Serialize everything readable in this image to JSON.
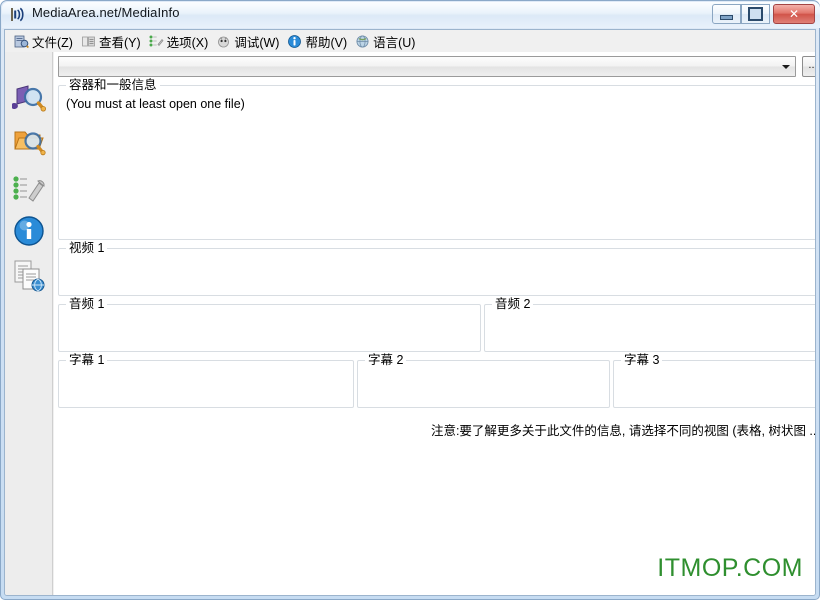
{
  "window": {
    "title": "MediaArea.net/MediaInfo",
    "app_icon": "sound-wave-icon",
    "controls": {
      "minimize": "minimize-button",
      "maximize": "maximize-button",
      "close": "close-button",
      "close_glyph": "✕"
    }
  },
  "menubar": {
    "items": [
      {
        "label": "文件(Z)",
        "icon": "file-icon"
      },
      {
        "label": "查看(Y)",
        "icon": "view-icon"
      },
      {
        "label": "选项(X)",
        "icon": "options-icon"
      },
      {
        "label": "调试(W)",
        "icon": "debug-icon"
      },
      {
        "label": "帮助(V)",
        "icon": "help-icon"
      },
      {
        "label": "语言(U)",
        "icon": "language-icon"
      }
    ]
  },
  "sidebar": {
    "items": [
      {
        "name": "open-file",
        "icon": "open-file-icon"
      },
      {
        "name": "open-folder",
        "icon": "open-folder-icon"
      },
      {
        "name": "options",
        "icon": "wrench-options-icon"
      },
      {
        "name": "about-info",
        "icon": "info-circle-icon"
      },
      {
        "name": "export",
        "icon": "export-documents-icon"
      }
    ]
  },
  "toolbar": {
    "file_combo_value": "",
    "file_combo_placeholder": "",
    "browse_label": "...",
    "dropdown_icon": "chevron-down-icon"
  },
  "panels": {
    "general": {
      "title": "容器和一般信息",
      "body": "(You must at least open one file)"
    },
    "video1": {
      "title": "视频 1",
      "body": ""
    },
    "audio1": {
      "title": "音频 1",
      "body": ""
    },
    "audio2": {
      "title": "音频 2",
      "body": ""
    },
    "subtitle1": {
      "title": "字幕 1",
      "body": ""
    },
    "subtitle2": {
      "title": "字幕 2",
      "body": ""
    },
    "subtitle3": {
      "title": "字幕 3",
      "body": ""
    }
  },
  "note": {
    "text": "注意:要了解更多关于此文件的信息, 请选择不同的视图 (表格, 树状图 ...)",
    "button_label": "–→"
  },
  "watermark": {
    "text": "ITMOP.COM",
    "color": "#2f8f2f"
  }
}
